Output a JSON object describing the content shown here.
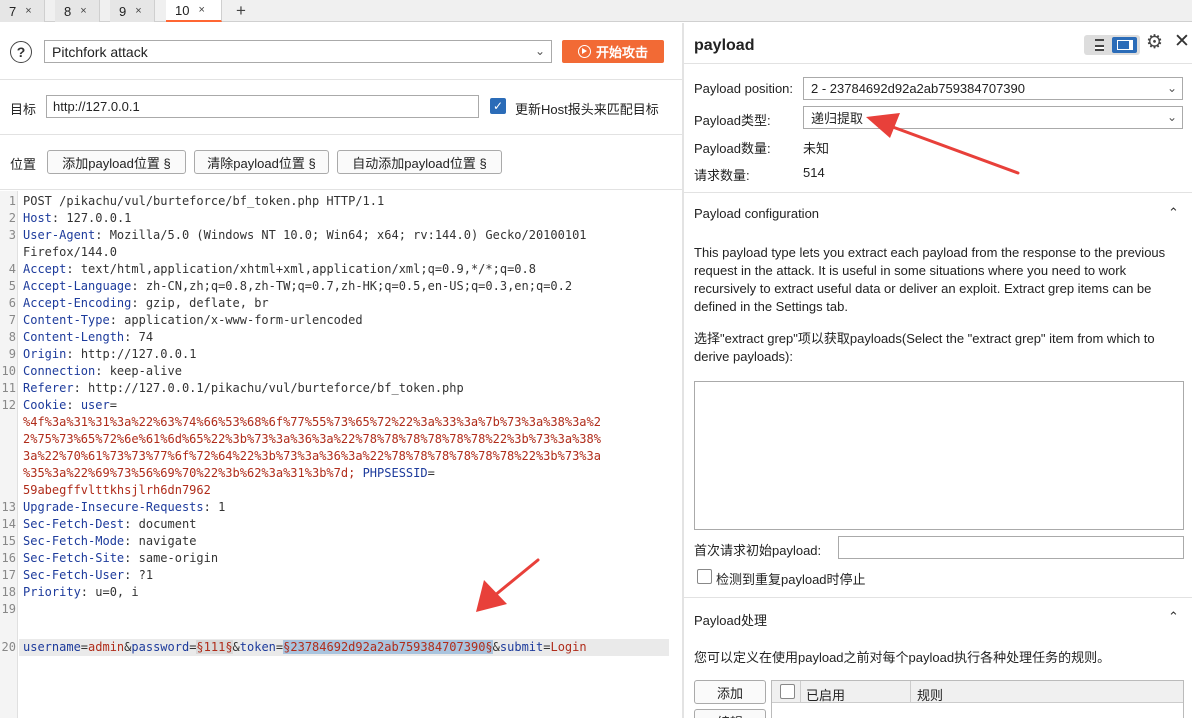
{
  "tabs": [
    {
      "label": "7",
      "close": "×"
    },
    {
      "label": "8",
      "close": "×"
    },
    {
      "label": "9",
      "close": "×"
    },
    {
      "label": "10",
      "close": "×"
    }
  ],
  "tab_add": "+",
  "attack": {
    "type": "Pitchfork attack",
    "start_label": "开始攻击"
  },
  "target": {
    "label": "目标",
    "value": "http://127.0.0.1",
    "host_label": "更新Host报头来匹配目标"
  },
  "positions": {
    "label": "位置",
    "add": "添加payload位置 §",
    "clear": "清除payload位置 §",
    "auto": "自动添加payload位置 §"
  },
  "request": {
    "line1": "POST /pikachu/vul/burteforce/bf_token.php HTTP/1.1",
    "headers": [
      {
        "n": "2",
        "key": "Host",
        "value": " 127.0.0.1"
      },
      {
        "n": "3",
        "key": "User-Agent",
        "value": " Mozilla/5.0 (Windows NT 10.0; Win64; x64; rv:144.0) Gecko/20100101"
      },
      {
        "n": "",
        "key": "",
        "value": "Firefox/144.0"
      },
      {
        "n": "4",
        "key": "Accept",
        "value": " text/html,application/xhtml+xml,application/xml;q=0.9,*/*;q=0.8"
      },
      {
        "n": "5",
        "key": "Accept-Language",
        "value": " zh-CN,zh;q=0.8,zh-TW;q=0.7,zh-HK;q=0.5,en-US;q=0.3,en;q=0.2"
      },
      {
        "n": "6",
        "key": "Accept-Encoding",
        "value": " gzip, deflate, br"
      },
      {
        "n": "7",
        "key": "Content-Type",
        "value": " application/x-www-form-urlencoded"
      },
      {
        "n": "8",
        "key": "Content-Length",
        "value": " 74"
      },
      {
        "n": "9",
        "key": "Origin",
        "value": " http://127.0.0.1"
      },
      {
        "n": "10",
        "key": "Connection",
        "value": " keep-alive"
      },
      {
        "n": "11",
        "key": "Referer",
        "value": " http://127.0.0.1/pikachu/vul/burteforce/bf_token.php"
      }
    ],
    "cookie_n": "12",
    "cookie_key": "Cookie",
    "cookie_name": " user",
    "cookie_lines": [
      "%4f%3a%31%31%3a%22%63%74%66%53%68%6f%77%55%73%65%72%22%3a%33%3a%7b%73%3a%38%3a%2",
      "2%75%73%65%72%6e%61%6d%65%22%3b%73%3a%36%3a%22%78%78%78%78%78%78%22%3b%73%3a%38%",
      "3a%22%70%61%73%73%77%6f%72%64%22%3b%73%3a%36%3a%22%78%78%78%78%78%78%22%3b%73%3a",
      "%35%3a%22%69%73%56%69%70%22%3b%62%3a%31%3b%7d;"
    ],
    "phpsess_key": " PHPSESSID",
    "phpsess_val": "59abegffvlttkhsjlrh6dn7962",
    "headers2": [
      {
        "n": "13",
        "key": "Upgrade-Insecure-Requests",
        "value": " 1"
      },
      {
        "n": "14",
        "key": "Sec-Fetch-Dest",
        "value": " document"
      },
      {
        "n": "15",
        "key": "Sec-Fetch-Mode",
        "value": " navigate"
      },
      {
        "n": "16",
        "key": "Sec-Fetch-Site",
        "value": " same-origin"
      },
      {
        "n": "17",
        "key": "Sec-Fetch-User",
        "value": " ?1"
      },
      {
        "n": "18",
        "key": "Priority",
        "value": " u=0, i"
      }
    ],
    "blank_n": "19",
    "body_n": "20",
    "body": {
      "p1": "username",
      "v1": "admin",
      "p2": "password",
      "m2": "§111§",
      "p3": "token",
      "m3": "§23784692d92a2ab759384707390§",
      "p4": "submit",
      "v4": "Login"
    }
  },
  "payload_panel": {
    "title": "payload",
    "position_label": "Payload position:",
    "position_value": "2 - 23784692d92a2ab759384707390",
    "type_label": "Payload类型:",
    "type_value": "递归提取",
    "count_label": "Payload数量:",
    "count_value": "未知",
    "requests_label": "请求数量:",
    "requests_value": "514",
    "config_title": "Payload configuration",
    "config_desc": "This payload type lets you extract each payload from the response to the previous request in the attack. It is useful in some situations where you need to work recursively to extract useful data or deliver an exploit. Extract grep items can be defined in the Settings tab.",
    "grep_label": "选择\"extract grep\"项以获取payloads(Select the \"extract grep\" item from which to derive payloads):",
    "initial_label": "首次请求初始payload:",
    "stop_label": "检测到重复payload时停止",
    "processing_title": "Payload处理",
    "processing_desc": "您可以定义在使用payload之前对每个payload执行各种处理任务的规则。",
    "add_label": "添加",
    "edit_label": "编辑",
    "col_enabled": "已启用",
    "col_rule": "规则"
  },
  "colors": {
    "accent": "#f26a35",
    "blue": "#2b6cb8",
    "arrow": "#e8403a"
  }
}
